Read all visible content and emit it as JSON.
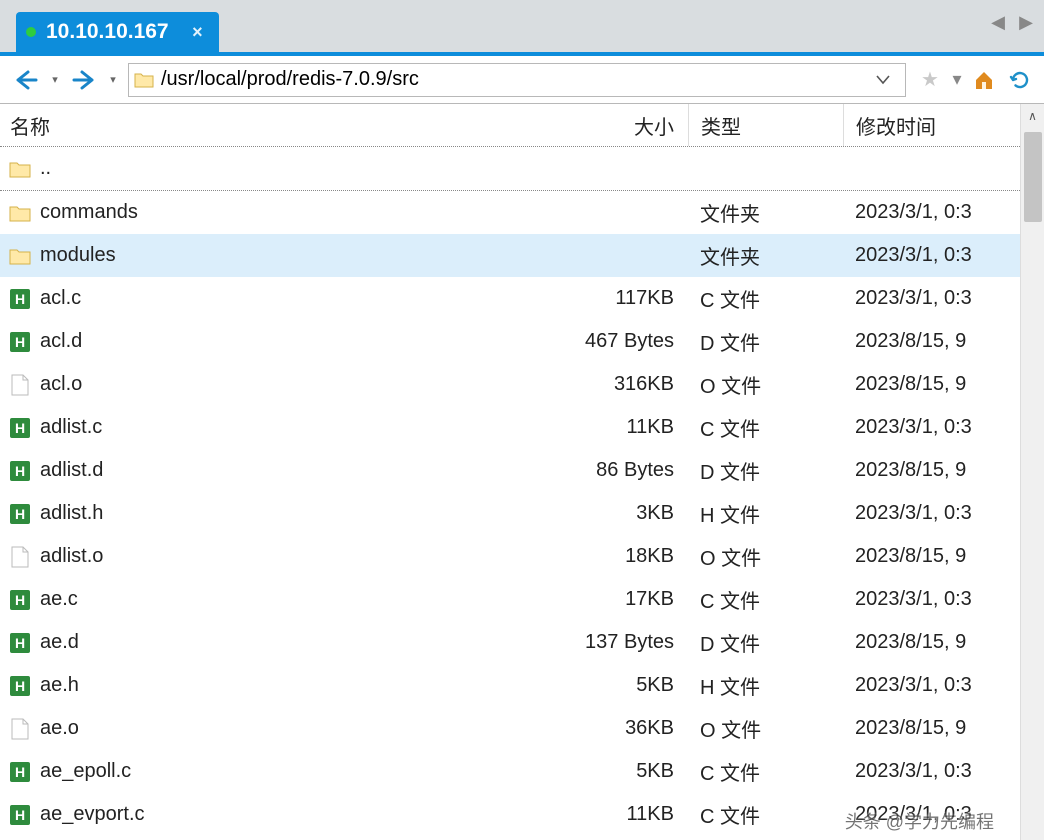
{
  "tab": {
    "title": "10.10.10.167",
    "close_glyph": "×"
  },
  "nav": {
    "back_glyph": "←",
    "fwd_glyph": "→",
    "drop_glyph": "▾",
    "address": "/usr/local/prod/redis-7.0.9/src",
    "caret_glyph": "⌄",
    "star_glyph": "★",
    "home_glyph": "⌂",
    "refresh_glyph": "⟳",
    "tabprev_glyph": "◀",
    "tabnext_glyph": "▶",
    "marker_glyph": "︿"
  },
  "headers": {
    "name": "名称",
    "size": "大小",
    "type": "类型",
    "date": "修改时间"
  },
  "parent_label": "..",
  "rows": [
    {
      "icon": "folder",
      "name": "commands",
      "size": "",
      "type": "文件夹",
      "date": "2023/3/1, 0:3",
      "sel": false
    },
    {
      "icon": "folder",
      "name": "modules",
      "size": "",
      "type": "文件夹",
      "date": "2023/3/1, 0:3",
      "sel": true
    },
    {
      "icon": "h",
      "name": "acl.c",
      "size": "117KB",
      "type": "C 文件",
      "date": "2023/3/1, 0:3",
      "sel": false
    },
    {
      "icon": "h",
      "name": "acl.d",
      "size": "467 Bytes",
      "type": "D 文件",
      "date": "2023/8/15, 9",
      "sel": false
    },
    {
      "icon": "blank",
      "name": "acl.o",
      "size": "316KB",
      "type": "O 文件",
      "date": "2023/8/15, 9",
      "sel": false
    },
    {
      "icon": "h",
      "name": "adlist.c",
      "size": "11KB",
      "type": "C 文件",
      "date": "2023/3/1, 0:3",
      "sel": false
    },
    {
      "icon": "h",
      "name": "adlist.d",
      "size": "86 Bytes",
      "type": "D 文件",
      "date": "2023/8/15, 9",
      "sel": false
    },
    {
      "icon": "h",
      "name": "adlist.h",
      "size": "3KB",
      "type": "H 文件",
      "date": "2023/3/1, 0:3",
      "sel": false
    },
    {
      "icon": "blank",
      "name": "adlist.o",
      "size": "18KB",
      "type": "O 文件",
      "date": "2023/8/15, 9",
      "sel": false
    },
    {
      "icon": "h",
      "name": "ae.c",
      "size": "17KB",
      "type": "C 文件",
      "date": "2023/3/1, 0:3",
      "sel": false
    },
    {
      "icon": "h",
      "name": "ae.d",
      "size": "137 Bytes",
      "type": "D 文件",
      "date": "2023/8/15, 9",
      "sel": false
    },
    {
      "icon": "h",
      "name": "ae.h",
      "size": "5KB",
      "type": "H 文件",
      "date": "2023/3/1, 0:3",
      "sel": false
    },
    {
      "icon": "blank",
      "name": "ae.o",
      "size": "36KB",
      "type": "O 文件",
      "date": "2023/8/15, 9",
      "sel": false
    },
    {
      "icon": "h",
      "name": "ae_epoll.c",
      "size": "5KB",
      "type": "C 文件",
      "date": "2023/3/1, 0:3",
      "sel": false
    },
    {
      "icon": "h",
      "name": "ae_evport.c",
      "size": "11KB",
      "type": "C 文件",
      "date": "2023/3/1, 0:3",
      "sel": false
    }
  ],
  "scroll": {
    "up_glyph": "∧"
  },
  "watermark": "头条 @学力先编程"
}
